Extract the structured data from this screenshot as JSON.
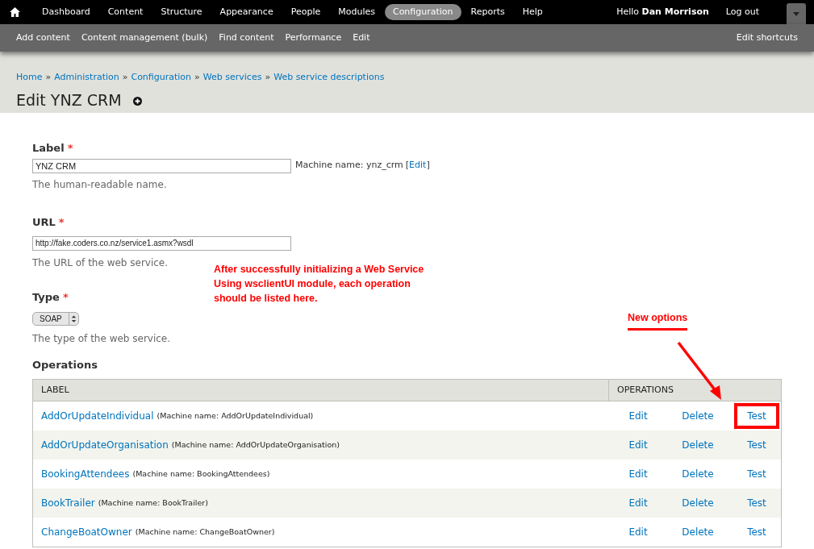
{
  "toolbar": {
    "menu": [
      {
        "label": "Dashboard",
        "selected": false
      },
      {
        "label": "Content",
        "selected": false
      },
      {
        "label": "Structure",
        "selected": false
      },
      {
        "label": "Appearance",
        "selected": false
      },
      {
        "label": "People",
        "selected": false
      },
      {
        "label": "Modules",
        "selected": false
      },
      {
        "label": "Configuration",
        "selected": true
      },
      {
        "label": "Reports",
        "selected": false
      },
      {
        "label": "Help",
        "selected": false
      }
    ],
    "greeting": "Hello **Dan Morrison**",
    "logout": "Log out"
  },
  "shortcuts": {
    "items": [
      "Add content",
      "Content management (bulk)",
      "Find content",
      "Performance",
      "Edit"
    ],
    "edit_shortcuts": "Edit shortcuts"
  },
  "breadcrumb": [
    "Home",
    "Administration",
    "Configuration",
    "Web services",
    "Web service descriptions"
  ],
  "breadcrumb_separator": "»",
  "page_title": "Edit YNZ CRM",
  "required_mark": "*",
  "form": {
    "label": {
      "title": "Label",
      "required": true,
      "value": "YNZ CRM",
      "machine_name": "Machine name: ynz_crm",
      "bracket_open": "[",
      "machine_edit": "Edit",
      "bracket_close": "]",
      "description": "The human-readable name."
    },
    "url": {
      "title": "URL",
      "required": true,
      "value": "http://fake.coders.co.nz/service1.asmx?wsdl",
      "description": "The URL of the web service."
    },
    "type": {
      "title": "Type",
      "required": true,
      "value": "SOAP",
      "description": "The type of the web service."
    }
  },
  "operations": {
    "title": "Operations",
    "columns": [
      "LABEL",
      "OPERATIONS"
    ],
    "rows": [
      {
        "name": "AddOrUpdateIndividual",
        "machine": "(Machine name: AddOrUpdateIndividual)",
        "edit": "Edit",
        "delete": "Delete",
        "test": "Test",
        "highlighted": true
      },
      {
        "name": "AddOrUpdateOrganisation",
        "machine": "(Machine name: AddOrUpdateOrganisation)",
        "edit": "Edit",
        "delete": "Delete",
        "test": "Test",
        "highlighted": false
      },
      {
        "name": "BookingAttendees",
        "machine": "(Machine name: BookingAttendees)",
        "edit": "Edit",
        "delete": "Delete",
        "test": "Test",
        "highlighted": false
      },
      {
        "name": "BookTrailer",
        "machine": "(Machine name: BookTrailer)",
        "edit": "Edit",
        "delete": "Delete",
        "test": "Test",
        "highlighted": false
      },
      {
        "name": "ChangeBoatOwner",
        "machine": "(Machine name: ChangeBoatOwner)",
        "edit": "Edit",
        "delete": "Delete",
        "test": "Test",
        "highlighted": false
      }
    ]
  },
  "annotations": {
    "note": [
      "After successfully initializing a Web Service",
      "Using wsclientUI module, each operation",
      "should be listed here."
    ],
    "callout": "New options"
  }
}
